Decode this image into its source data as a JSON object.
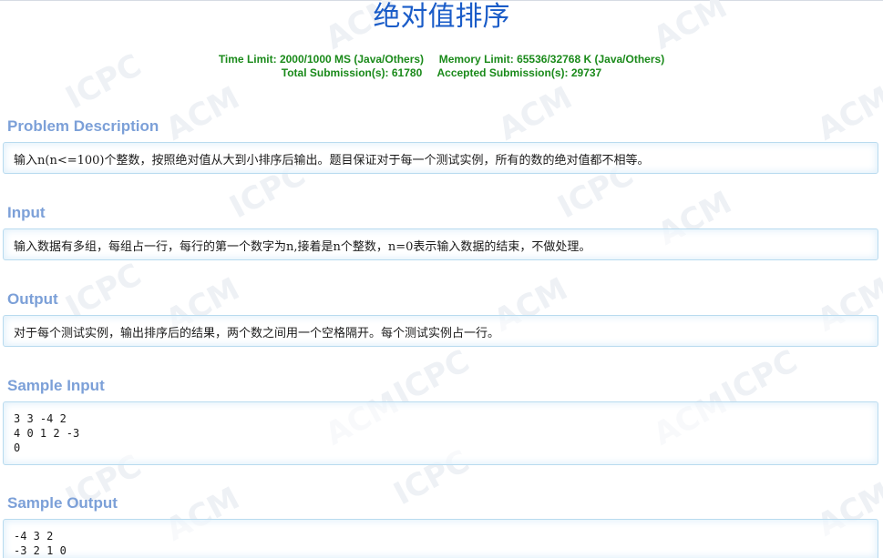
{
  "problem": {
    "title": "绝对值排序",
    "time_limit_label": "Time Limit:",
    "time_limit_value": "2000/1000 MS (Java/Others)",
    "memory_limit_label": "Memory Limit:",
    "memory_limit_value": "65536/32768 K (Java/Others)",
    "total_submissions_label": "Total Submission(s):",
    "total_submissions_value": "61780",
    "accepted_submissions_label": "Accepted Submission(s):",
    "accepted_submissions_value": "29737"
  },
  "sections": {
    "description": {
      "heading": "Problem Description",
      "content": "输入n(n<=100)个整数，按照绝对值从大到小排序后输出。题目保证对于每一个测试实例，所有的数的绝对值都不相等。"
    },
    "input": {
      "heading": "Input",
      "content": "输入数据有多组，每组占一行，每行的第一个数字为n,接着是n个整数，n=0表示输入数据的结束，不做处理。"
    },
    "output": {
      "heading": "Output",
      "content": "对于每个测试实例，输出排序后的结果，两个数之间用一个空格隔开。每个测试实例占一行。"
    },
    "sample_input": {
      "heading": "Sample Input",
      "content": "3 3 -4 2\n4 0 1 2 -3\n0"
    },
    "sample_output": {
      "heading": "Sample Output",
      "content": "-4 3 2\n-3 2 1 0"
    }
  },
  "watermark": {
    "acm": "ACM",
    "icpc": "ICPC"
  }
}
